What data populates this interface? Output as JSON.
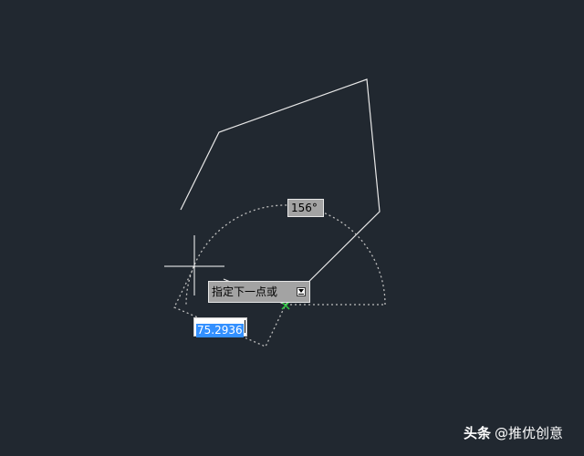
{
  "canvas": {
    "background": "#212830",
    "line_color": "#e8e8e8",
    "tracking_color": "#bdbdbd",
    "snap_marker_color": "#2ecc40"
  },
  "dynamic_input": {
    "angle_value": "156°",
    "prompt_text": "指定下一点或",
    "options_icon": "options-arrow-icon",
    "length_value": "75.2936"
  },
  "cursor": {
    "icon": "crosshair-icon"
  },
  "watermark": {
    "brand": "头条",
    "handle": "@推优创意"
  }
}
